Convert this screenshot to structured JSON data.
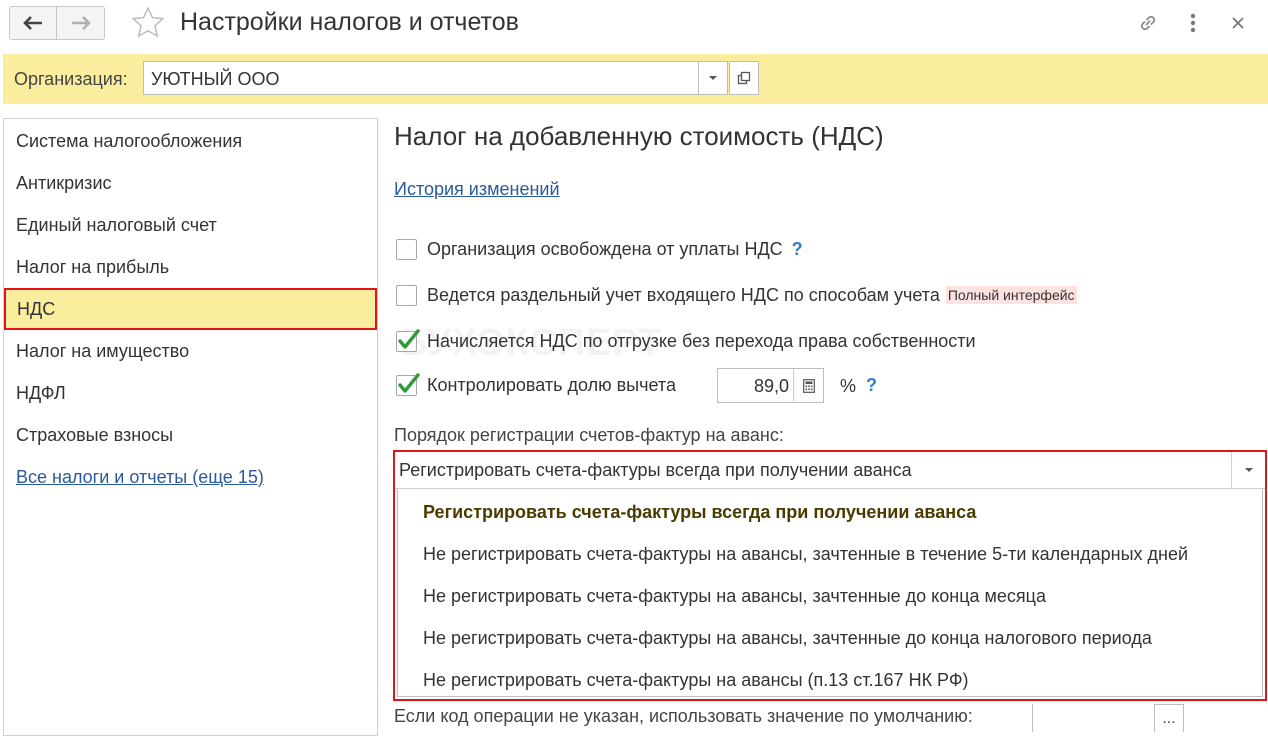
{
  "window": {
    "title": "Настройки налогов и отчетов"
  },
  "organization": {
    "label": "Организация:",
    "value": "УЮТНЫЙ ООО"
  },
  "sidebar": {
    "items": [
      {
        "label": "Система налогообложения"
      },
      {
        "label": "Антикризис"
      },
      {
        "label": "Единый налоговый счет"
      },
      {
        "label": "Налог на прибыль"
      },
      {
        "label": "НДС"
      },
      {
        "label": "Налог на имущество"
      },
      {
        "label": "НДФЛ"
      },
      {
        "label": "Страховые взносы"
      }
    ],
    "all_link": "Все налоги и отчеты (еще 15)"
  },
  "main": {
    "title": "Налог на добавленную стоимость (НДС)",
    "history_link": "История изменений",
    "checkboxes": [
      {
        "label": "Организация освобождена от уплаты НДС",
        "checked": false,
        "help": "?"
      },
      {
        "label": "Ведется раздельный учет входящего НДС по способам учета",
        "checked": false,
        "badge": "Полный интерфейс"
      },
      {
        "label": "Начисляется НДС по отгрузке без перехода права собственности",
        "checked": true
      },
      {
        "label": "Контролировать долю вычета",
        "checked": true
      }
    ],
    "deduction_share": {
      "value": "89,0",
      "unit": "%",
      "help": "?"
    },
    "order_label": "Порядок регистрации счетов-фактур на аванс:",
    "order_value": "Регистрировать счета-фактуры всегда при получении аванса",
    "order_options": [
      "Регистрировать счета-фактуры всегда при получении аванса",
      "Не регистрировать счета-фактуры на авансы, зачтенные в течение 5-ти календарных дней",
      "Не регистрировать счета-фактуры на авансы, зачтенные до конца месяца",
      "Не регистрировать счета-фактуры на авансы, зачтенные до конца налогового периода",
      "Не регистрировать счета-фактуры на авансы (п.13 ст.167 НК РФ)"
    ],
    "bottom_label": "Если код операции не указан, использовать значение по умолчанию:",
    "bottom_button": "..."
  },
  "watermark": "БУХЭКСПЕРТ",
  "colors": {
    "highlight": "#fbed9e",
    "callout_border": "#e0141a",
    "link": "#2a5a9b",
    "check": "#2e9a3a"
  }
}
